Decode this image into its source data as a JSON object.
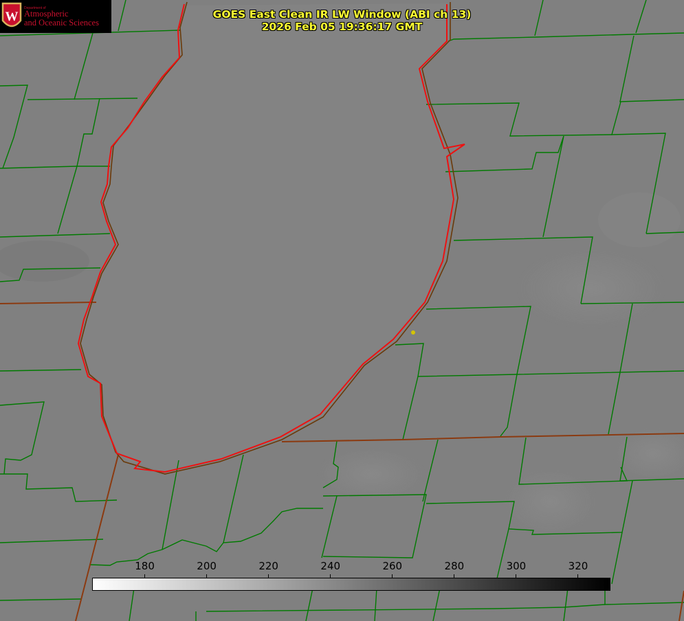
{
  "logo": {
    "department": "Department of",
    "line1": "Atmospheric",
    "line2": "and Oceanic Sciences",
    "shield_letter": "W"
  },
  "title": {
    "line1": "GOES East Clean IR LW Window (ABI ch 13)",
    "line2": "2026 Feb 05 19:36:17 GMT"
  },
  "colorbar": {
    "min": 163,
    "max": 330,
    "gradient_from": "#ffffff",
    "gradient_to": "#000000",
    "ticks": [
      {
        "value": 180,
        "label": "180"
      },
      {
        "value": 200,
        "label": "200"
      },
      {
        "value": 220,
        "label": "220"
      },
      {
        "value": 240,
        "label": "240"
      },
      {
        "value": 260,
        "label": "260"
      },
      {
        "value": 280,
        "label": "280"
      },
      {
        "value": 300,
        "label": "300"
      },
      {
        "value": 320,
        "label": "320"
      }
    ]
  },
  "colors": {
    "background_gray": "#808080",
    "county_border": "#007a00",
    "state_border": "#8b3a10",
    "shoreline": "#ee1111",
    "title_text": "#ffff33",
    "marker": "#d4c400"
  },
  "map": {
    "lake_label": "",
    "marker_icon": "station-marker-icon"
  }
}
